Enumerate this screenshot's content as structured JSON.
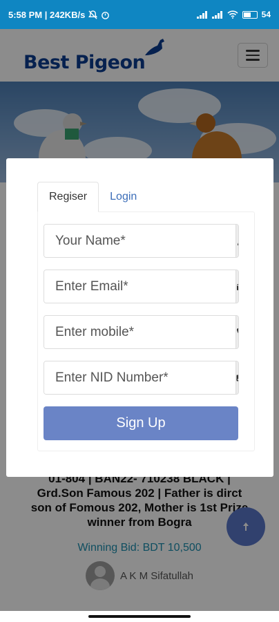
{
  "status_bar": {
    "time_speed": "5:58 PM | 242KB/s",
    "battery": "54"
  },
  "header": {
    "logo_text": "Best Pigeon",
    "menu_icon": "hamburger-icon"
  },
  "listing": {
    "title_line1": "01-804 | BAN22- 710238 BLACK |",
    "title_rest": "Grd.Son Famous 202 | Father is dirct son of Fomous 202, Mother is 1st Prize winner from Bogra",
    "winning_bid": "Winning Bid: BDT 10,500",
    "bidder_name": "A K M Sifatullah"
  },
  "modal": {
    "tabs": [
      {
        "label": "Regiser",
        "active": true
      },
      {
        "label": "Login",
        "active": false
      }
    ],
    "fields": [
      {
        "placeholder": "Your Name*",
        "icon": "user-icon"
      },
      {
        "placeholder": "Enter Email*",
        "icon": "envelope-icon"
      },
      {
        "placeholder": "Enter mobile*",
        "icon": "phone-icon"
      },
      {
        "placeholder": "Enter NID Number*",
        "icon": "id-card-icon"
      }
    ],
    "submit_label": "Sign Up"
  },
  "colors": {
    "status_bar": "#0f86c2",
    "primary_button": "#6a84c6",
    "link": "#3b6db8",
    "winning_bid": "#1c8fb0"
  }
}
